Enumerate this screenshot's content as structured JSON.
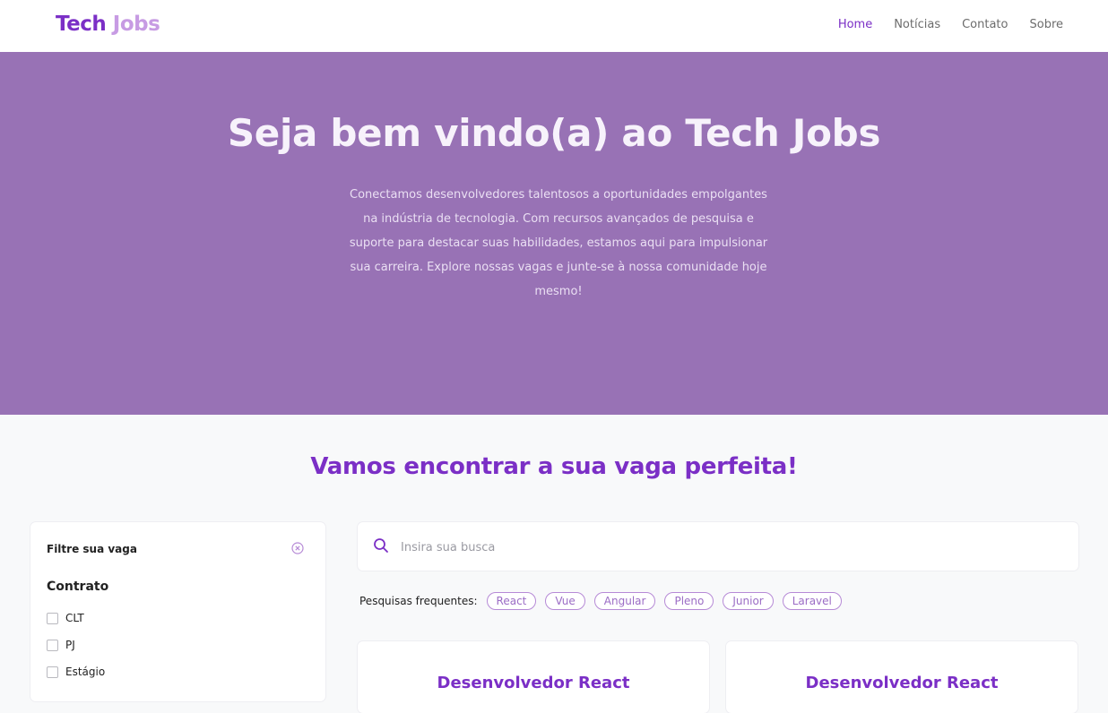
{
  "header": {
    "logo_part1": "Tech",
    "logo_part2": "Jobs",
    "nav": [
      "Home",
      "Notícias",
      "Contato",
      "Sobre"
    ]
  },
  "hero": {
    "title": "Seja bem vindo(a) ao Tech Jobs",
    "description_lines": [
      "Conectamos desenvolvedores talentosos a oportunidades empolgantes",
      "na indústria de tecnologia. Com recursos avançados de pesquisa e",
      "suporte para destacar suas habilidades, estamos aqui para impulsionar",
      "sua carreira. Explore nossas vagas e junte-se à nossa comunidade hoje",
      "mesmo!"
    ]
  },
  "section": {
    "title": "Vamos encontrar a sua vaga perfeita!"
  },
  "filter": {
    "title": "Filtre sua vaga",
    "clear_icon": "clear-circle-icon",
    "contract_title": "Contrato",
    "options": [
      "CLT",
      "PJ",
      "Estágio"
    ]
  },
  "search": {
    "placeholder": "Insira sua busca",
    "value": "",
    "icon": "search-icon"
  },
  "frequent": {
    "label": "Pesquisas frequentes:",
    "chips": [
      "React",
      "Vue",
      "Angular",
      "Pleno",
      "Junior",
      "Laravel"
    ]
  },
  "cards": [
    {
      "title": "Desenvolvedor React"
    },
    {
      "title": "Desenvolvedor React"
    }
  ],
  "colors": {
    "brand": "#7b2fc6",
    "brand_light": "#c79be3",
    "hero_bg": "#9872b5",
    "page_bg": "#f8f9fa"
  }
}
